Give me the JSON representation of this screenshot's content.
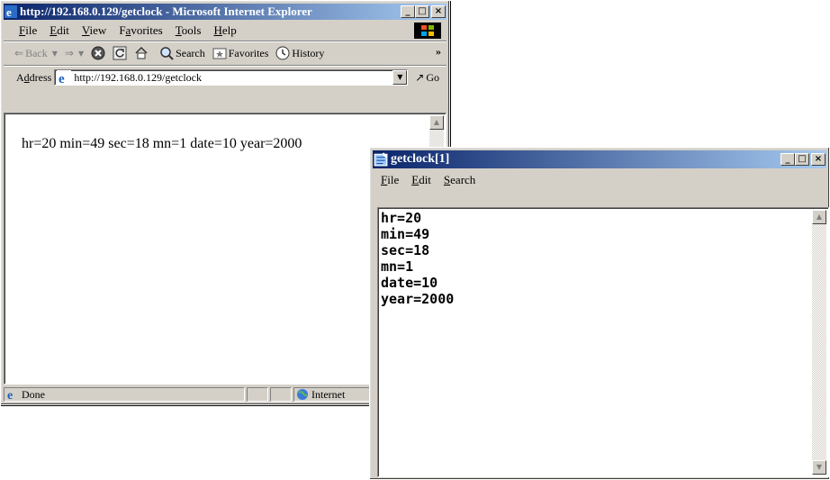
{
  "ie": {
    "title": "http://192.168.0.129/getclock - Microsoft Internet Explorer",
    "menu": [
      "File",
      "Edit",
      "View",
      "Favorites",
      "Tools",
      "Help"
    ],
    "menu_underline": [
      "F",
      "E",
      "V",
      "a",
      "T",
      "H"
    ],
    "toolbar": {
      "back": "Back",
      "search": "Search",
      "favorites": "Favorites",
      "history": "History",
      "more": "»"
    },
    "address_label": "Address",
    "address_value": "http://192.168.0.129/getclock",
    "go_label": "Go",
    "page_text": "hr=20 min=49 sec=18 mn=1 date=10 year=2000",
    "status": {
      "text": "Done",
      "zone": "Internet"
    }
  },
  "notepad": {
    "title": "getclock[1]",
    "menu": [
      "File",
      "Edit",
      "Search"
    ],
    "lines": [
      "hr=20",
      "min=49",
      "sec=18",
      "mn=1",
      "date=10",
      "year=2000"
    ]
  },
  "icons": {
    "ie_logo": "internet-explorer-icon",
    "notepad_logo": "notepad-icon",
    "windows_logo": "windows-flag-icon",
    "globe": "globe-icon"
  },
  "colors": {
    "title_active_start": "#0a246a",
    "title_active_end": "#a6caf0",
    "chrome": "#d4d0c8"
  }
}
